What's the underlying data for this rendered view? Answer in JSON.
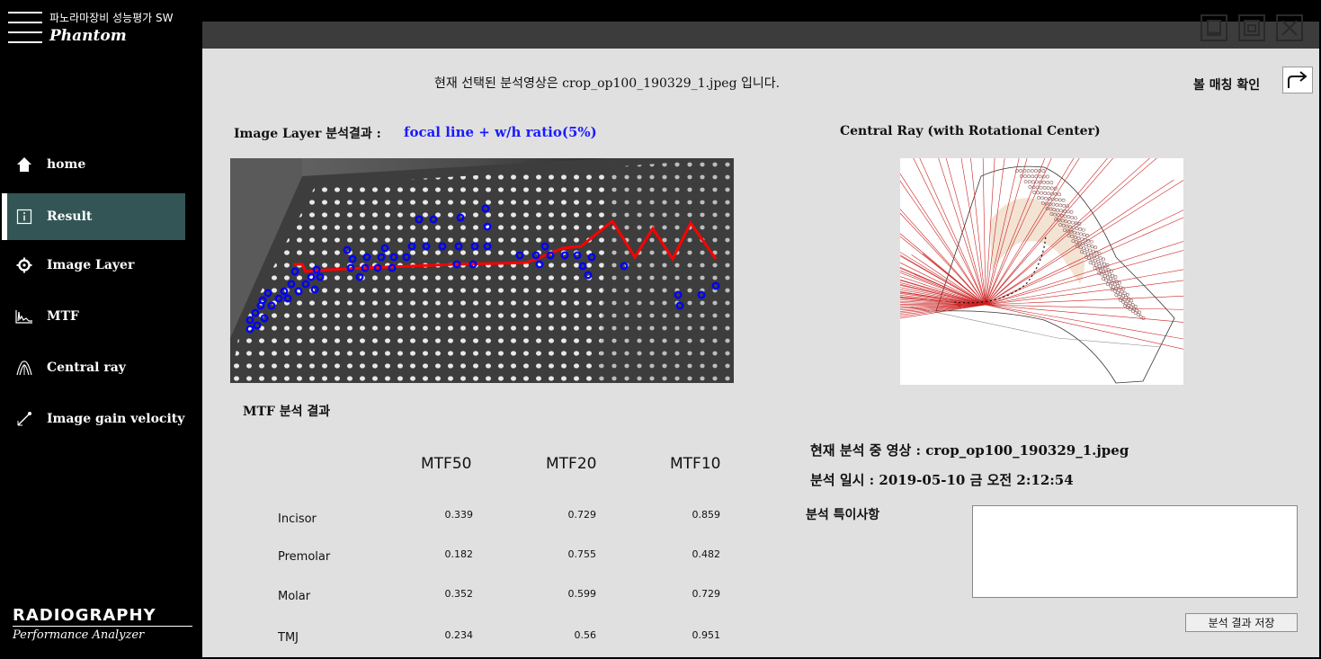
{
  "sidebar": {
    "subtitle": "파노라마장비 성능평가 SW",
    "app_name": "Phantom",
    "items": [
      {
        "label": "home"
      },
      {
        "label": "Result"
      },
      {
        "label": "Image Layer"
      },
      {
        "label": "MTF"
      },
      {
        "label": "Central ray"
      },
      {
        "label": "Image gain velocity"
      }
    ],
    "brand": {
      "main": "RADIOGRAPHY",
      "sub": "Performance Analyzer"
    }
  },
  "header": {
    "selected_image_text": "현재 선택된 분석영상은 crop_op100_190329_1.jpeg 입니다.",
    "match_label": "볼 매칭 확인"
  },
  "image_layer": {
    "title": "Image Layer 분석결과 :",
    "value": "focal line + w/h ratio(5%)"
  },
  "central_ray": {
    "title": "Central Ray (with Rotational Center)"
  },
  "mtf": {
    "title": "MTF 분석 결과",
    "columns": [
      "MTF50",
      "MTF20",
      "MTF10"
    ],
    "rows": [
      {
        "label": "Incisor",
        "values": [
          "0.339",
          "0.729",
          "0.859"
        ]
      },
      {
        "label": "Premolar",
        "values": [
          "0.182",
          "0.755",
          "0.482"
        ]
      },
      {
        "label": "Molar",
        "values": [
          "0.352",
          "0.599",
          "0.729"
        ]
      },
      {
        "label": "TMJ",
        "values": [
          "0.234",
          "0.56",
          "0.951"
        ]
      }
    ]
  },
  "analysis": {
    "current_image": "현재 분석 중 영상 : crop_op100_190329_1.jpeg",
    "analysis_date": "분석 일시 : 2019-05-10 금 오전 2:12:54",
    "note_label": "분석 특이사항",
    "note_value": "",
    "save_label": "분석 결과 저장"
  },
  "colors": {
    "sidebar_bg": "#000000",
    "active_item": "#335555",
    "content_bg": "#e0e0e0",
    "topbar": "#3c3c3c",
    "accent_text": "#1a1aff",
    "focal_line": "#ff0000",
    "ball_marker": "#0000ff"
  }
}
